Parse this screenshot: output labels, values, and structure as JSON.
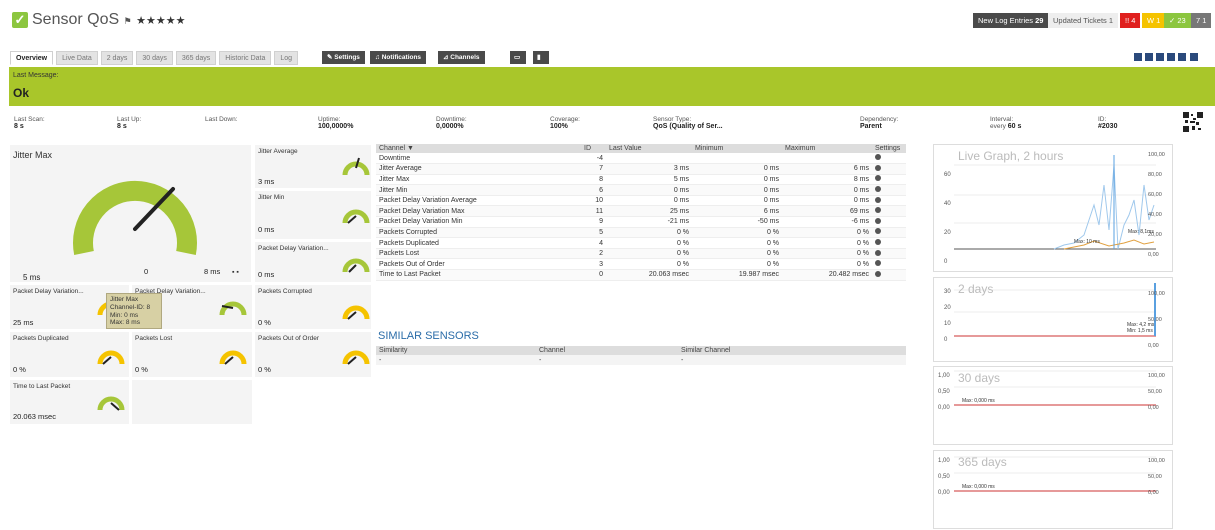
{
  "header": {
    "title": "Sensor QoS",
    "stars": "★★★★★",
    "new_log_label": "New Log Entries",
    "new_log_count": "29",
    "updated_tickets_label": "Updated Tickets",
    "updated_tickets_count": "1",
    "alarm_down": "!! 4",
    "alarm_warn": "W 1",
    "alarm_up": "✓ 23",
    "alarm_paused": "7 1"
  },
  "tabs": [
    "Overview",
    "Live Data",
    "2 days",
    "30 days",
    "365 days",
    "Historic Data",
    "Log"
  ],
  "actions": {
    "settings": "Settings",
    "notifications": "Notifications",
    "channels": "Channels"
  },
  "message": {
    "label": "Last Message:",
    "value": "Ok"
  },
  "info": {
    "last_scan_label": "Last Scan:",
    "last_scan": "8 s",
    "last_up_label": "Last Up:",
    "last_up": "8 s",
    "last_down_label": "Last Down:",
    "last_down": "",
    "uptime_label": "Uptime:",
    "uptime": "100,0000%",
    "downtime_label": "Downtime:",
    "downtime": "0,0000%",
    "coverage_label": "Coverage:",
    "coverage": "100%",
    "sensor_type_label": "Sensor Type:",
    "sensor_type": "QoS (Quality of Ser...",
    "dependency_label": "Dependency:",
    "dependency": "Parent",
    "interval_label": "Interval:",
    "interval_prefix": "every",
    "interval": "60 s",
    "id_label": "ID:",
    "id": "#2030"
  },
  "gauges": {
    "main": {
      "title": "Jitter Max",
      "value": "5 ms",
      "min": "0",
      "max": "8 ms",
      "level": 0.62
    },
    "jitter_avg": {
      "title": "Jitter Average",
      "value": "3 ms"
    },
    "jitter_min": {
      "title": "Jitter Min",
      "value": "0 ms"
    },
    "pdv_avg": {
      "title": "Packet Delay Variation...",
      "value": "0 ms"
    },
    "pdv_max": {
      "title": "Packet Delay Variation...",
      "value": "25 ms"
    },
    "pdv_min": {
      "title": "Packet Delay Variation...",
      "value": ""
    },
    "corrupted": {
      "title": "Packets Corrupted",
      "value": "0 %"
    },
    "duplicated": {
      "title": "Packets Duplicated",
      "value": "0 %"
    },
    "lost": {
      "title": "Packets Lost",
      "value": "0 %"
    },
    "out_of_order": {
      "title": "Packets Out of Order",
      "value": "0 %"
    },
    "time_to_last": {
      "title": "Time to Last Packet",
      "value": "20.063 msec"
    }
  },
  "tooltip": {
    "line1": "Jitter Max",
    "line2": "Channel-ID: 8",
    "line3": "Min: 0 ms",
    "line4": "Max: 8 ms"
  },
  "channels_table": {
    "headers": [
      "Channel ▼",
      "ID",
      "Last Value",
      "Minimum",
      "Maximum",
      "Settings"
    ],
    "rows": [
      [
        "Downtime",
        "-4",
        "",
        "",
        ""
      ],
      [
        "Jitter Average",
        "7",
        "3 ms",
        "0 ms",
        "6 ms"
      ],
      [
        "Jitter Max",
        "8",
        "5 ms",
        "0 ms",
        "8 ms"
      ],
      [
        "Jitter Min",
        "6",
        "0 ms",
        "0 ms",
        "0 ms"
      ],
      [
        "Packet Delay Variation Average",
        "10",
        "0 ms",
        "0 ms",
        "0 ms"
      ],
      [
        "Packet Delay Variation Max",
        "11",
        "25 ms",
        "6 ms",
        "69 ms"
      ],
      [
        "Packet Delay Variation Min",
        "9",
        "-21 ms",
        "-50 ms",
        "-6 ms"
      ],
      [
        "Packets Corrupted",
        "5",
        "0 %",
        "0 %",
        "0 %"
      ],
      [
        "Packets Duplicated",
        "4",
        "0 %",
        "0 %",
        "0 %"
      ],
      [
        "Packets Lost",
        "2",
        "0 %",
        "0 %",
        "0 %"
      ],
      [
        "Packets Out of Order",
        "3",
        "0 %",
        "0 %",
        "0 %"
      ],
      [
        "Time to Last Packet",
        "0",
        "20.063 msec",
        "19.987 msec",
        "20.482 msec"
      ]
    ]
  },
  "similar": {
    "title": "SIMILAR SENSORS",
    "headers": [
      "Similarity",
      "Channel",
      "Similar Channel"
    ],
    "row": [
      "-",
      "-",
      "-"
    ]
  },
  "graphs": [
    {
      "title": "Live Graph, 2 hours",
      "y_left": [
        "60",
        "40",
        "20",
        "0"
      ],
      "y_right": [
        "100,00",
        "80,00",
        "60,00",
        "40,00",
        "20,00",
        "0,00"
      ],
      "note1": "Max: 8,1ms",
      "note2": "Max: 10 ms",
      "ylabel": "ms"
    },
    {
      "title": "2 days",
      "y_left": [
        "30",
        "20",
        "10",
        "0"
      ],
      "y_right": [
        "100,00",
        "50,00",
        "0,00"
      ],
      "note1": "Max: 4,2 ms",
      "note2": "Min: 1,5 ms",
      "ylabel": "ms"
    },
    {
      "title": "30 days",
      "y_left": [
        "1,00",
        "0,50",
        "0,00"
      ],
      "y_right": [
        "100,00",
        "50,00",
        "0,00"
      ],
      "note1": "Max: 0,000 ms",
      "note2": "",
      "ylabel": "ms"
    },
    {
      "title": "365 days",
      "y_left": [
        "1,00",
        "0,50",
        "0,00"
      ],
      "y_right": [
        "100,00",
        "50,00",
        "0,00"
      ],
      "note1": "Max: 0,000 ms",
      "note2": "",
      "ylabel": "ms"
    }
  ],
  "colors": {
    "accent": "#8cc63f",
    "message": "#a9c62a",
    "gauge_green": "#a6c639",
    "gauge_yellow": "#f5c300",
    "down": "#e0201e",
    "warn": "#f5c300",
    "up": "#8cc63f",
    "paused": "#777777"
  }
}
